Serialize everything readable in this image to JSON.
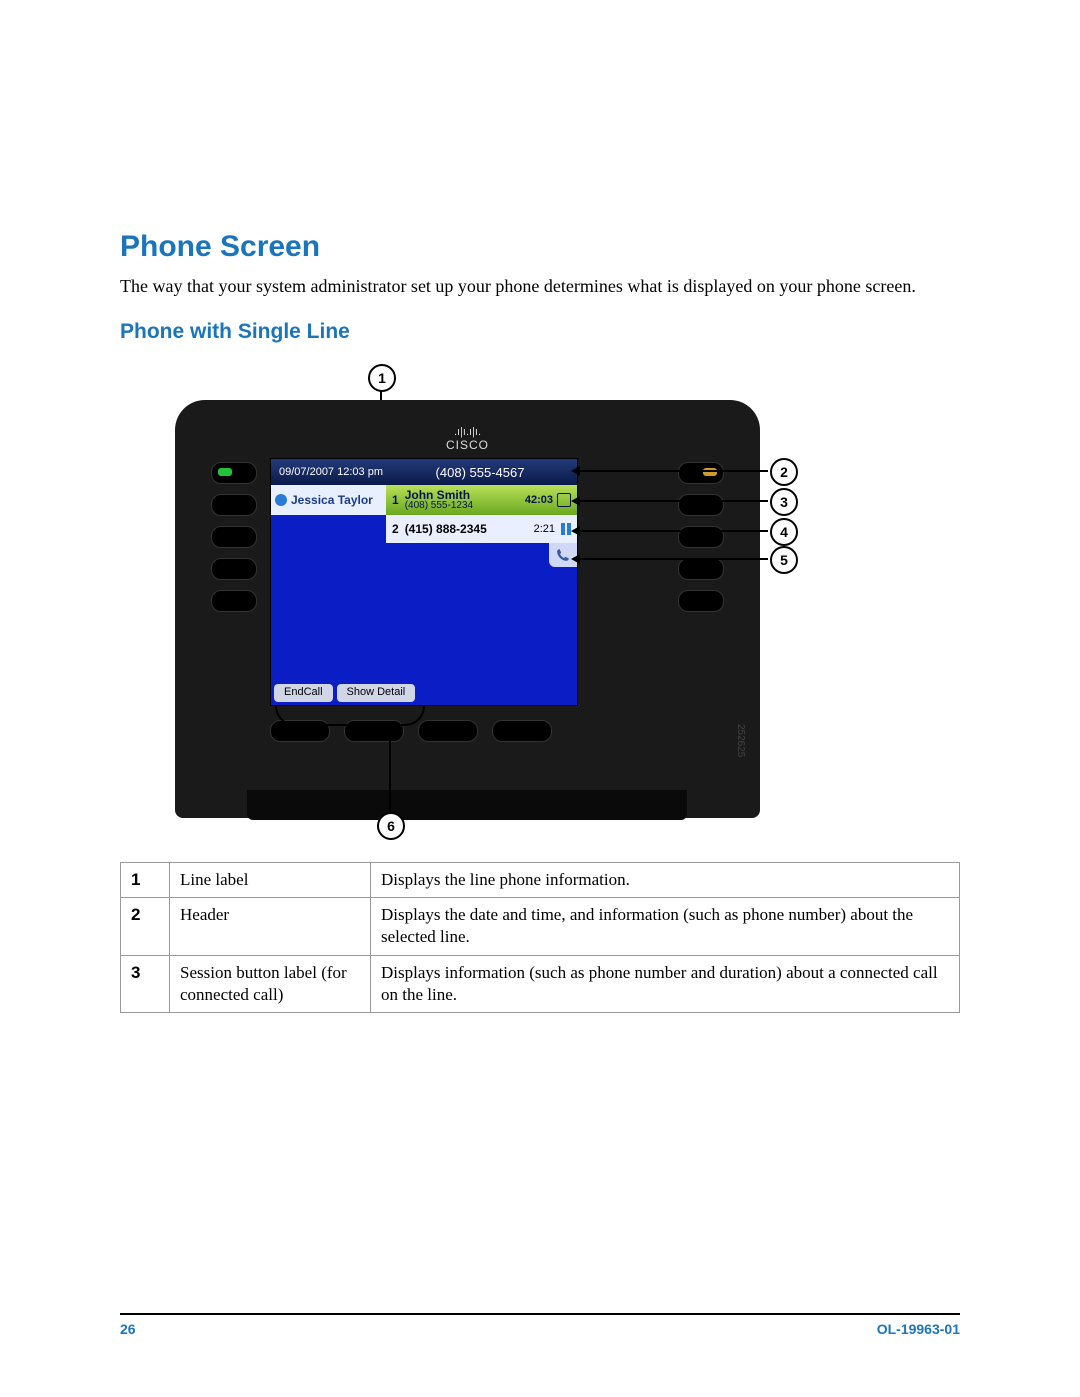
{
  "headings": {
    "h1": "Phone Screen",
    "intro": "The way that your system administrator set up your phone determines what is displayed on your phone screen.",
    "h2": "Phone with Single Line"
  },
  "logo": {
    "bars": ".ı|ı.ı|ı.",
    "name": "CISCO"
  },
  "screen": {
    "date": "09/07/2007",
    "time": "12:03 pm",
    "header_number": "(408) 555-4567",
    "line_label": "Jessica Taylor",
    "session1": {
      "index": "1",
      "name": "John Smith",
      "number": "(408) 555-1234",
      "duration": "42:03"
    },
    "session2": {
      "index": "2",
      "number": "(415) 888-2345",
      "duration": "2:21"
    },
    "softkeys": [
      "EndCall",
      "Show Detail"
    ]
  },
  "figure_id": "252625",
  "callouts": {
    "c1": "1",
    "c2": "2",
    "c3": "3",
    "c4": "4",
    "c5": "5",
    "c6": "6"
  },
  "legend": [
    {
      "n": "1",
      "label": "Line label",
      "desc": "Displays the line phone information."
    },
    {
      "n": "2",
      "label": "Header",
      "desc": "Displays the date and time, and information (such as phone number) about the selected line."
    },
    {
      "n": "3",
      "label": "Session button label (for connected call)",
      "desc": "Displays information (such as phone number and duration) about a connected call on the line."
    }
  ],
  "footer": {
    "page": "26",
    "doc": "OL-19963-01"
  }
}
